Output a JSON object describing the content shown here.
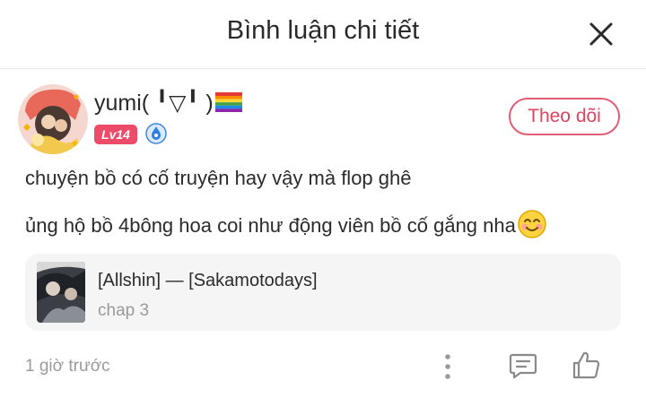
{
  "header": {
    "title": "Bình luận chi tiết",
    "close_icon": "close-icon"
  },
  "user": {
    "name": "yumi( ╹▽╹ )",
    "flag_icon": "rainbow-flag-icon",
    "level": "Lv14",
    "badge_icon": "blue-verified-badge-icon"
  },
  "follow": {
    "label": "Theo dõi"
  },
  "comment": {
    "line1": "chuyện bồ có cố truyện hay vậy mà flop ghê",
    "line2": "ủng hộ bồ 4bông hoa coi như động viên bồ cố gắng nha",
    "emoji_icon": "smiley-emoji-icon"
  },
  "story": {
    "title": "[Allshin] — [Sakamotodays]",
    "chapter": "chap 3"
  },
  "footer": {
    "time": "1 giờ trước",
    "more_icon": "more-vertical-icon",
    "reply_icon": "comment-icon",
    "like_icon": "thumbs-up-icon"
  },
  "colors": {
    "accent": "#e45c74",
    "level_badge": "#ee4b68",
    "card_bg": "#f5f5f5",
    "muted_text": "#9b9b9b"
  }
}
